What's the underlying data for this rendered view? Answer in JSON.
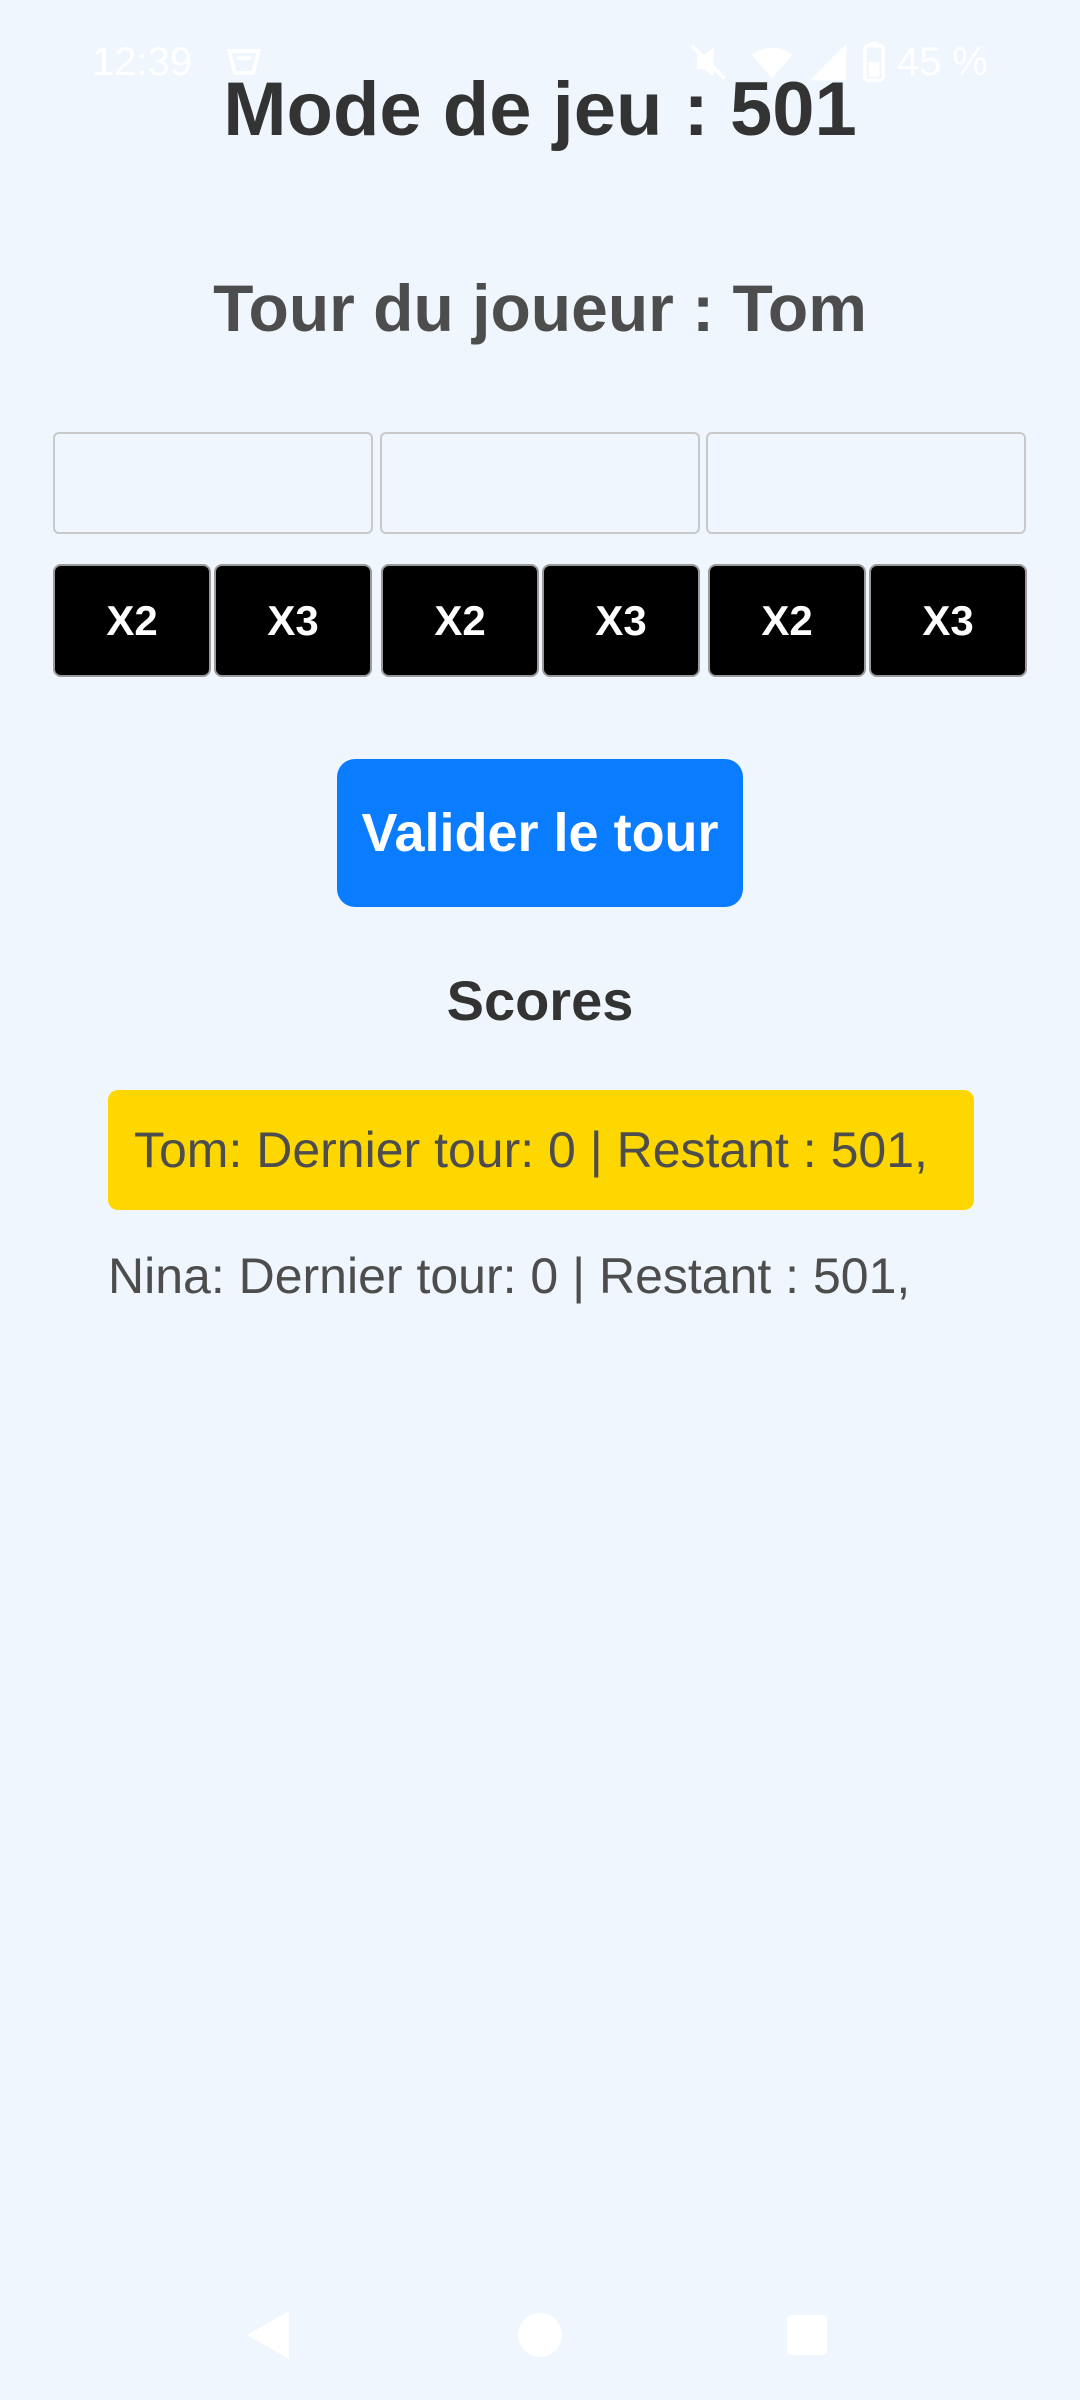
{
  "status_bar": {
    "time": "12:39",
    "battery": "45 %",
    "icons": [
      "vpn-key-icon",
      "mute-icon",
      "wifi-icon",
      "signal-icon",
      "battery-icon"
    ]
  },
  "game": {
    "mode_title": "Mode de jeu : 501",
    "turn_title": "Tour du joueur : Tom"
  },
  "darts": [
    {
      "value": "",
      "x2_label": "X2",
      "x3_label": "X3"
    },
    {
      "value": "",
      "x2_label": "X2",
      "x3_label": "X3"
    },
    {
      "value": "",
      "x2_label": "X2",
      "x3_label": "X3"
    }
  ],
  "validate_label": "Valider le tour",
  "scores": {
    "title": "Scores",
    "rows": [
      {
        "text": "Tom: Dernier tour: 0 | Restant : 501,",
        "active": true
      },
      {
        "text": "Nina: Dernier tour: 0 | Restant : 501,",
        "active": false
      }
    ]
  },
  "colors": {
    "background": "#eff6fe",
    "primary_button": "#0a7cff",
    "active_row": "#ffd700",
    "multiplier_button": "#000000"
  },
  "nav_bar": {
    "icons": [
      "back-icon",
      "home-icon",
      "recents-icon"
    ]
  }
}
